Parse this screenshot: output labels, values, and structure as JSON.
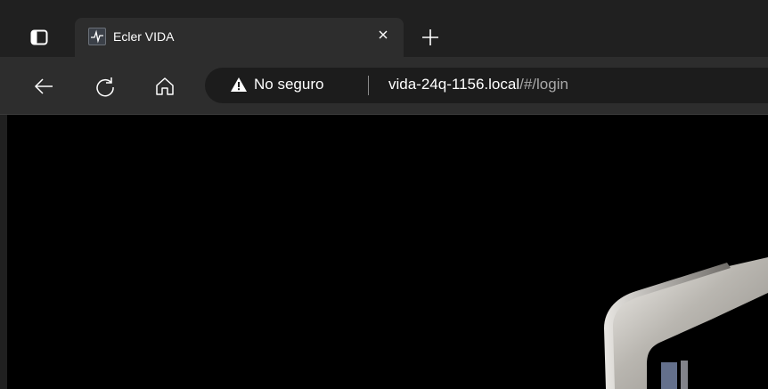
{
  "tab": {
    "title": "Ecler VIDA",
    "favicon": "pulse-icon"
  },
  "toolbar": {
    "back": "back-arrow-icon",
    "refresh": "refresh-icon",
    "home": "home-icon"
  },
  "omnibox": {
    "security_label": "No seguro",
    "host": "vida-24q-1156.local",
    "path": "/#/login"
  },
  "colors": {
    "tabstrip": "#202020",
    "toolbar": "#2d2d2d",
    "omnibox": "#1c1c1c",
    "page": "#000000"
  }
}
